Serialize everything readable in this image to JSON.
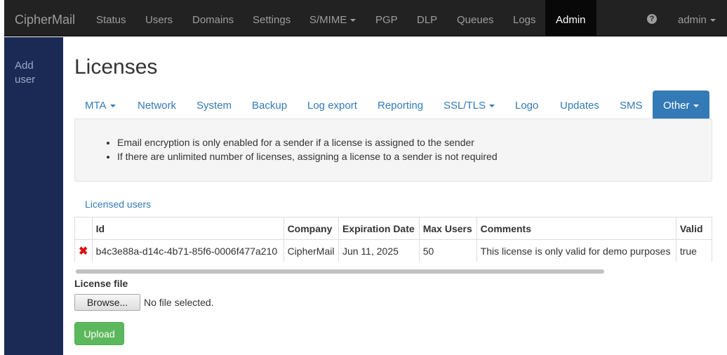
{
  "navbar": {
    "brand": "CipherMail",
    "items": [
      {
        "label": "Status"
      },
      {
        "label": "Users"
      },
      {
        "label": "Domains"
      },
      {
        "label": "Settings"
      },
      {
        "label": "S/MIME"
      },
      {
        "label": "PGP"
      },
      {
        "label": "DLP"
      },
      {
        "label": "Queues"
      },
      {
        "label": "Logs"
      },
      {
        "label": "Admin"
      }
    ],
    "help_icon": "question-circle-icon",
    "help_glyph": "?",
    "user_menu": "admin",
    "colors": {
      "background": "#222222",
      "text": "#9d9d9d",
      "active_bg": "#080808",
      "active_text": "#ffffff"
    }
  },
  "sidebar": {
    "link": "Add user",
    "color": "#1b2a55"
  },
  "page": {
    "title": "Licenses"
  },
  "tabs": [
    {
      "label": "MTA"
    },
    {
      "label": "Network"
    },
    {
      "label": "System"
    },
    {
      "label": "Backup"
    },
    {
      "label": "Log export"
    },
    {
      "label": "Reporting"
    },
    {
      "label": "SSL/TLS"
    },
    {
      "label": "Logo"
    },
    {
      "label": "Updates"
    },
    {
      "label": "SMS"
    },
    {
      "label": "Other"
    }
  ],
  "info": {
    "items": [
      "Email encryption is only enabled for a sender if a license is assigned to the sender",
      "If there are unlimited number of licenses, assigning a license to a sender is not required"
    ]
  },
  "licensed_users_link": "Licensed users",
  "license_table": {
    "columns": [
      "",
      "Id",
      "Company",
      "Expiration Date",
      "Max Users",
      "Comments",
      "Valid"
    ],
    "rows": [
      {
        "delete_icon": "delete-x-icon",
        "delete_glyph": "✖",
        "id": "b4c3e88a-d14c-4b71-85f6-0006f477a210",
        "company": "CipherMail",
        "expiration_date": "Jun 11, 2025",
        "max_users": "50",
        "comments": "This license is only valid for demo purposes",
        "valid": "true"
      }
    ]
  },
  "license_file": {
    "label": "License file",
    "browse_label": "Browse...",
    "status": "No file selected."
  },
  "upload_label": "Upload",
  "colors": {
    "link": "#337ab7",
    "success": "#5cb85c",
    "danger": "#d9120f"
  }
}
